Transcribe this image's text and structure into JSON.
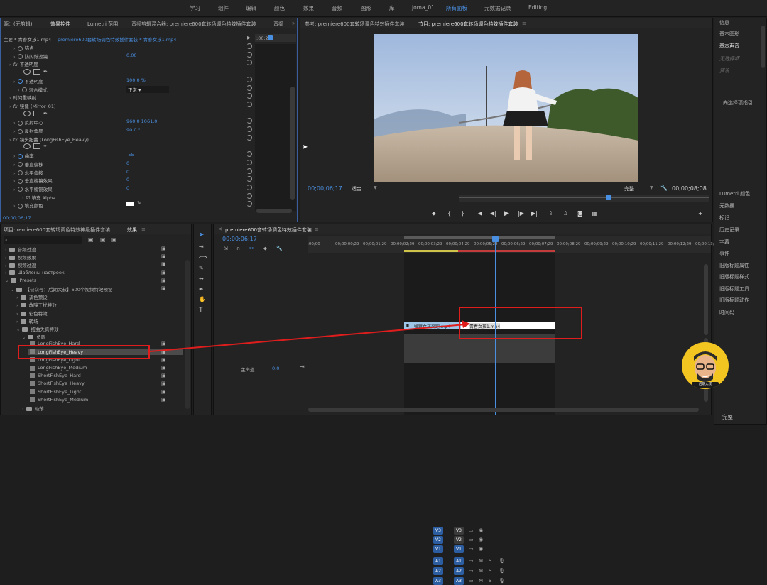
{
  "topbar": {
    "workspaces": [
      "学习",
      "组件",
      "编辑",
      "颜色",
      "效果",
      "音频",
      "图形",
      "库",
      "joma_01",
      "所有面板",
      "元数据记录",
      "Editing"
    ],
    "active_index": 9
  },
  "effect_controls": {
    "tabs": [
      "源：(无剪辑)",
      "效果控件",
      "Lumetri 范围",
      "音频剪辑混合器: premiere600套转场调色特效插件套装",
      "音频"
    ],
    "clip_path": "主要 * 青春女孩1.mp4",
    "sequence_path": "premiere600套转场调色特效插件套装 * 青春女孩1.mp4",
    "ruler_time": ":00:29",
    "rows": [
      {
        "label": "锚点",
        "value": "",
        "indent": 2
      },
      {
        "label": "防闪烁滤镜",
        "value": "0.00",
        "indent": 2
      },
      {
        "label": "不透明度",
        "value": "",
        "indent": 1,
        "fx": true
      },
      {
        "label": "",
        "value": "",
        "indent": 2,
        "shapes": true
      },
      {
        "label": "不透明度",
        "value": "100.0 %",
        "indent": 2,
        "sw": true
      },
      {
        "label": "混合模式",
        "value": "正常",
        "indent": 3,
        "dropdown": true
      },
      {
        "label": "时间重映射",
        "value": "",
        "indent": 1
      },
      {
        "label": "镜像 (Mirror_01)",
        "value": "",
        "indent": 1,
        "fx": true
      },
      {
        "label": "",
        "value": "",
        "indent": 2,
        "shapes": true
      },
      {
        "label": "反射中心",
        "value": "960.0    1061.0",
        "indent": 2
      },
      {
        "label": "反射角度",
        "value": "90.0 °",
        "indent": 2
      },
      {
        "label": "镜头扭曲 (LongFishEye_Heavy)",
        "value": "",
        "indent": 1,
        "fx": true
      },
      {
        "label": "",
        "value": "",
        "indent": 2,
        "shapes": true
      },
      {
        "label": "曲率",
        "value": "-55",
        "indent": 2,
        "sw": true
      },
      {
        "label": "垂直偏移",
        "value": "0",
        "indent": 2
      },
      {
        "label": "水平偏移",
        "value": "0",
        "indent": 2
      },
      {
        "label": "垂直棱镜效果",
        "value": "0",
        "indent": 2
      },
      {
        "label": "水平棱镜效果",
        "value": "0",
        "indent": 2
      },
      {
        "label": "填充 Alpha",
        "value": "",
        "indent": 4,
        "checkbox": true
      },
      {
        "label": "填充颜色",
        "value": "",
        "indent": 2,
        "color": true
      }
    ],
    "timecode": "00;00;06;17"
  },
  "program": {
    "source_tab": "参考: premiere600套转场调色特效插件套装",
    "program_tab": "节目: premiere600套转场调色特效插件套装",
    "timecode": "00;00;06;17",
    "fit": "适合",
    "quality": "完整",
    "duration": "00;00;08;08"
  },
  "project": {
    "tabs": [
      "项目: remiere600套转场调色特效神级插件套装",
      "效果"
    ],
    "tree": [
      {
        "label": "音频过渡",
        "depth": 0,
        "type": "folder"
      },
      {
        "label": "视频效果",
        "depth": 0,
        "type": "folder"
      },
      {
        "label": "视频过渡",
        "depth": 0,
        "type": "folder"
      },
      {
        "label": "Шаблоны настроек",
        "depth": 0,
        "type": "folder"
      },
      {
        "label": "Presets",
        "depth": 0,
        "type": "folder",
        "open": true
      },
      {
        "label": "【公众号：后期大叔】600个视频特效预设",
        "depth": 1,
        "type": "folder",
        "open": true
      },
      {
        "label": "调色预设",
        "depth": 2,
        "type": "folder"
      },
      {
        "label": "故障干扰特效",
        "depth": 2,
        "type": "folder"
      },
      {
        "label": "彩色特效",
        "depth": 2,
        "type": "folder"
      },
      {
        "label": "转场",
        "depth": 2,
        "type": "folder"
      },
      {
        "label": "扭曲失真特效",
        "depth": 2,
        "type": "folder",
        "open": true
      },
      {
        "label": "鱼眼",
        "depth": 3,
        "type": "folder",
        "open": true
      },
      {
        "label": "LongFishEye_Hard",
        "depth": 4,
        "type": "preset"
      },
      {
        "label": "LongFishEye_Heavy",
        "depth": 4,
        "type": "preset",
        "selected": true
      },
      {
        "label": "LongFishEye_Light",
        "depth": 4,
        "type": "preset"
      },
      {
        "label": "LongFishEye_Medium",
        "depth": 4,
        "type": "preset"
      },
      {
        "label": "ShortFishEye_Hard",
        "depth": 4,
        "type": "preset"
      },
      {
        "label": "ShortFishEye_Heavy",
        "depth": 4,
        "type": "preset"
      },
      {
        "label": "ShortFishEye_Light",
        "depth": 4,
        "type": "preset"
      },
      {
        "label": "ShortFishEye_Medium",
        "depth": 4,
        "type": "preset"
      },
      {
        "label": "动荡",
        "depth": 3,
        "type": "folder"
      }
    ]
  },
  "timeline": {
    "tab": "premiere600套转场调色特效插件套装",
    "timecode": "00;00;06;17",
    "ruler": [
      ":00;00",
      "00;00;00;29",
      "00;00;01;29",
      "00;00;02;29",
      "00;00;03;29",
      "00;00;04;29",
      "00;00;05;29",
      "00;00;06;29",
      "00;00;07;29",
      "00;00;08;29",
      "00;00;09;29",
      "00;00;10;29",
      "00;00;11;29",
      "00;00;12;29",
      "00;00;13;29"
    ],
    "tracks": [
      "V3",
      "V2",
      "V1",
      "A1",
      "A2",
      "A3"
    ],
    "master": "主声道",
    "master_value": "0.0",
    "clip1": "弹跳女孩奔跑.mp4",
    "clip2": "青春女孩1.mp4"
  },
  "right_panel": {
    "items": [
      "信息",
      "基本图形",
      "基本声音",
      "无选择项",
      "预设",
      "向选择项指引",
      "Lumetri 颜色",
      "元数据",
      "标记",
      "历史记录",
      "字幕",
      "事件",
      "旧版标题属性",
      "旧版标题样式",
      "旧版标题工具",
      "旧版标题动作",
      "时间码"
    ],
    "bottom": "完整"
  },
  "avatar_badge": "后期大叔"
}
